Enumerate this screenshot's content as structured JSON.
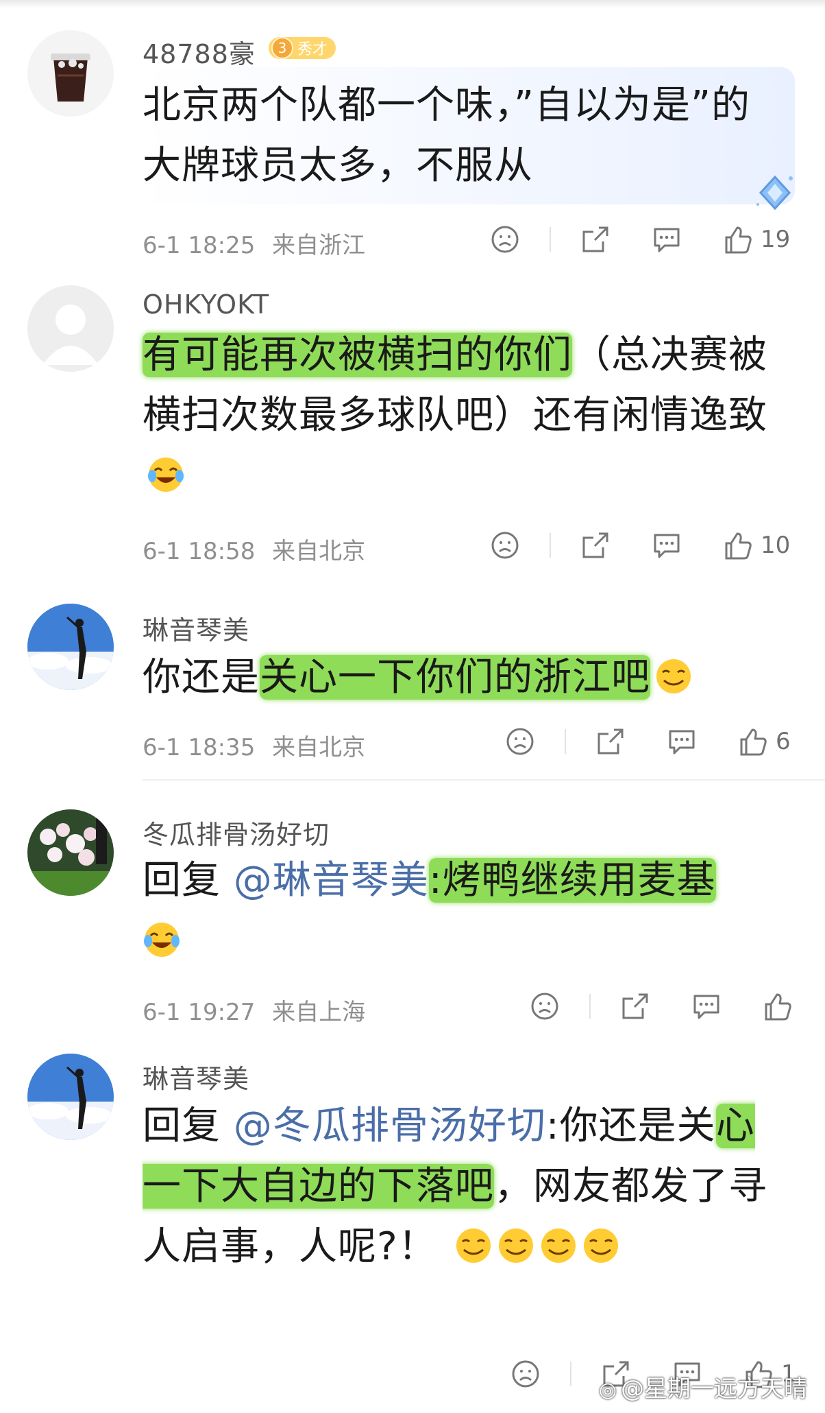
{
  "comments": [
    {
      "username": "48788豪",
      "badge": {
        "level": "3",
        "title": "秀才"
      },
      "text_parts": [
        "北京两个队都一个味，”自以为是”的大牌球员太多，不服从"
      ],
      "time": "6-1 18:25",
      "location": "来自浙江",
      "likes": "19",
      "avatar_icon": "drink-cup-icon"
    },
    {
      "username": "OHKYOKT",
      "text_parts": [
        "有可能再次被横扫的你们",
        "（总决赛被横扫次数最多球队吧）还有闲情逸致"
      ],
      "emoji": "laugh-cry-emoji",
      "time": "6-1 18:58",
      "location": "来自北京",
      "likes": "10",
      "avatar_icon": "default-avatar-icon"
    },
    {
      "username": "琳音琴美",
      "text_parts": [
        "你还是",
        "关心一下你们的浙江吧"
      ],
      "emoji": "smirk-emoji",
      "time": "6-1 18:35",
      "location": "来自北京",
      "likes": "6",
      "avatar_icon": "sky-photo-icon"
    },
    {
      "username": "冬瓜排骨汤好切",
      "reply_prefix": "回复",
      "mention": "@琳音琴美",
      "text_parts": [
        ":烤鸭继续用麦基"
      ],
      "emoji": "laugh-cry-emoji",
      "time": "6-1 19:27",
      "location": "来自上海",
      "likes": "",
      "avatar_icon": "flower-photo-icon"
    },
    {
      "username": "琳音琴美",
      "reply_prefix": "回复",
      "mention": "@冬瓜排骨汤好切",
      "text_parts": [
        ":你还是关",
        "心一下大自边的下落吧",
        "，网友都发了寻人启事，人呢?！"
      ],
      "emoji": "smirk-emoji",
      "time": "",
      "location": "",
      "likes": "1",
      "avatar_icon": "sky-photo-icon"
    }
  ],
  "watermark": {
    "text": "@星期一远方天晴",
    "logo": "weibo-logo-icon"
  },
  "colors": {
    "highlight": "#8fdc58",
    "mention": "#4a6ea8",
    "meta": "#8f8f8f",
    "badge": "#ffd66b"
  }
}
